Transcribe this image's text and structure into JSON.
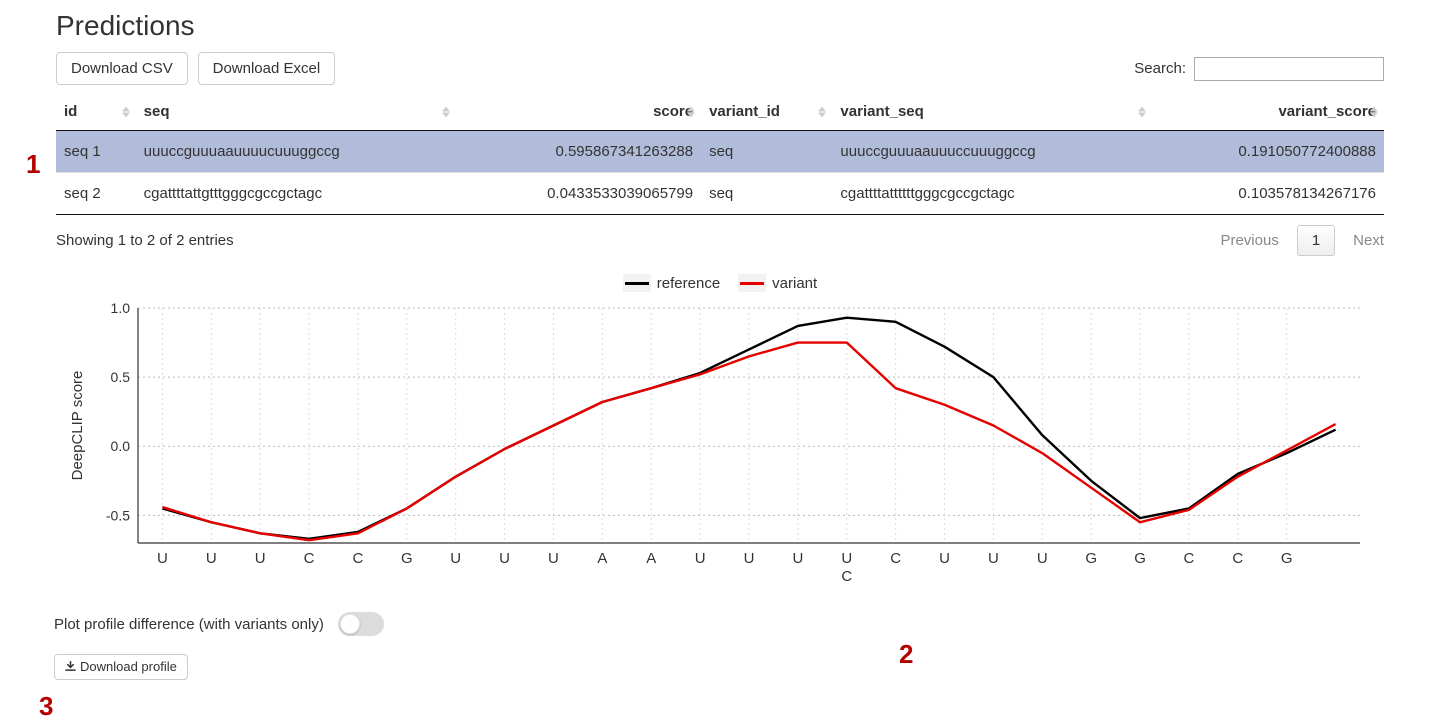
{
  "title": "Predictions",
  "toolbar": {
    "download_csv": "Download CSV",
    "download_excel": "Download Excel"
  },
  "search": {
    "label": "Search:",
    "value": ""
  },
  "columns": {
    "id": "id",
    "seq": "seq",
    "score": "score",
    "variant_id": "variant_id",
    "variant_seq": "variant_seq",
    "variant_score": "variant_score"
  },
  "rows": [
    {
      "id": "seq 1",
      "seq": "uuuccguuuaauuuucuuuggccg",
      "score": "0.595867341263288",
      "variant_id": "seq",
      "variant_seq": "uuuccguuuaauuuccuuuggccg",
      "variant_score": "0.191050772400888",
      "selected": true
    },
    {
      "id": "seq 2",
      "seq": "cgattttattgtttgggcgccgctagc",
      "score": "0.0433533039065799",
      "variant_id": "seq",
      "variant_seq": "cgattttattttttgggcgccgctagc",
      "variant_score": "0.103578134267176",
      "selected": false
    }
  ],
  "info_text": "Showing 1 to 2 of 2 entries",
  "pager": {
    "previous": "Previous",
    "next": "Next",
    "page": "1"
  },
  "legend": {
    "reference": "reference",
    "variant": "variant"
  },
  "chart_data": {
    "type": "line",
    "ylabel": "DeepCLIP score",
    "ylim": [
      -0.7,
      1.0
    ],
    "yticks": [
      -0.5,
      0.0,
      0.5,
      1.0
    ],
    "categories_top": [
      "U",
      "U",
      "U",
      "C",
      "C",
      "G",
      "U",
      "U",
      "U",
      "A",
      "A",
      "U",
      "U",
      "U",
      "U",
      "C",
      "U",
      "U",
      "U",
      "G",
      "G",
      "C",
      "C",
      "G"
    ],
    "categories_bottom": [
      "",
      "",
      "",
      "",
      "",
      "",
      "",
      "",
      "",
      "",
      "",
      "",
      "",
      "",
      "C",
      "",
      "",
      "",
      "",
      "",
      "",
      "",
      "",
      ""
    ],
    "series": [
      {
        "name": "reference",
        "color": "#000000",
        "values": [
          -0.45,
          -0.55,
          -0.63,
          -0.67,
          -0.62,
          -0.45,
          -0.22,
          -0.02,
          0.15,
          0.32,
          0.42,
          0.53,
          0.7,
          0.87,
          0.93,
          0.9,
          0.72,
          0.5,
          0.08,
          -0.25,
          -0.52,
          -0.45,
          -0.2,
          -0.05,
          0.12
        ]
      },
      {
        "name": "variant",
        "color": "#e60000",
        "values": [
          -0.44,
          -0.55,
          -0.63,
          -0.68,
          -0.63,
          -0.45,
          -0.22,
          -0.02,
          0.15,
          0.32,
          0.42,
          0.52,
          0.65,
          0.75,
          0.75,
          0.42,
          0.3,
          0.15,
          -0.05,
          -0.3,
          -0.55,
          -0.46,
          -0.22,
          -0.03,
          0.16
        ]
      }
    ]
  },
  "toggle_label": "Plot profile difference (with variants only)",
  "download_profile": "Download profile",
  "annotations": {
    "a1": "1",
    "a2": "2",
    "a3": "3"
  }
}
